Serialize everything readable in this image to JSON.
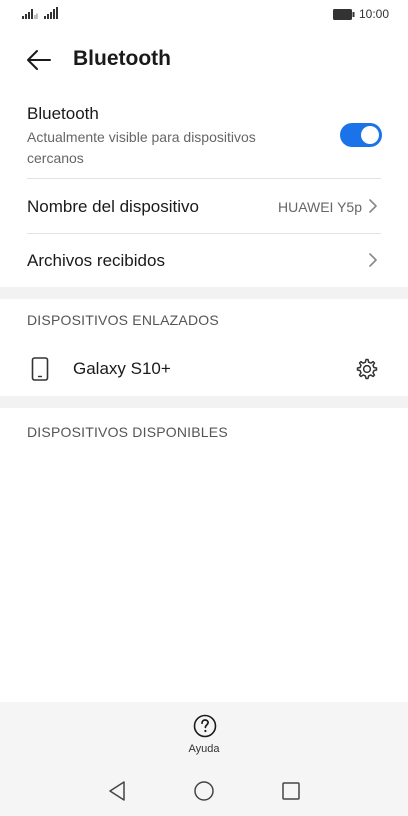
{
  "status_bar": {
    "time": "10:00"
  },
  "header": {
    "title": "Bluetooth"
  },
  "bluetooth": {
    "label": "Bluetooth",
    "description": "Actualmente visible para dispositivos cercanos",
    "enabled": true,
    "accent_color": "#1a73e8"
  },
  "settings": {
    "device_name_label": "Nombre del dispositivo",
    "device_name_value": "HUAWEI Y5p",
    "received_files_label": "Archivos recibidos"
  },
  "paired_section": {
    "header": "DISPOSITIVOS ENLAZADOS",
    "devices": [
      {
        "name": "Galaxy S10+",
        "icon": "phone-icon"
      }
    ]
  },
  "available_section": {
    "header": "DISPOSITIVOS DISPONIBLES"
  },
  "help": {
    "label": "Ayuda"
  },
  "icons": {
    "back": "back-arrow-icon",
    "chevron": "chevron-right-icon",
    "settings": "gear-icon",
    "help": "help-icon",
    "nav_back": "nav-back-icon",
    "nav_home": "nav-home-icon",
    "nav_recents": "nav-recents-icon"
  }
}
